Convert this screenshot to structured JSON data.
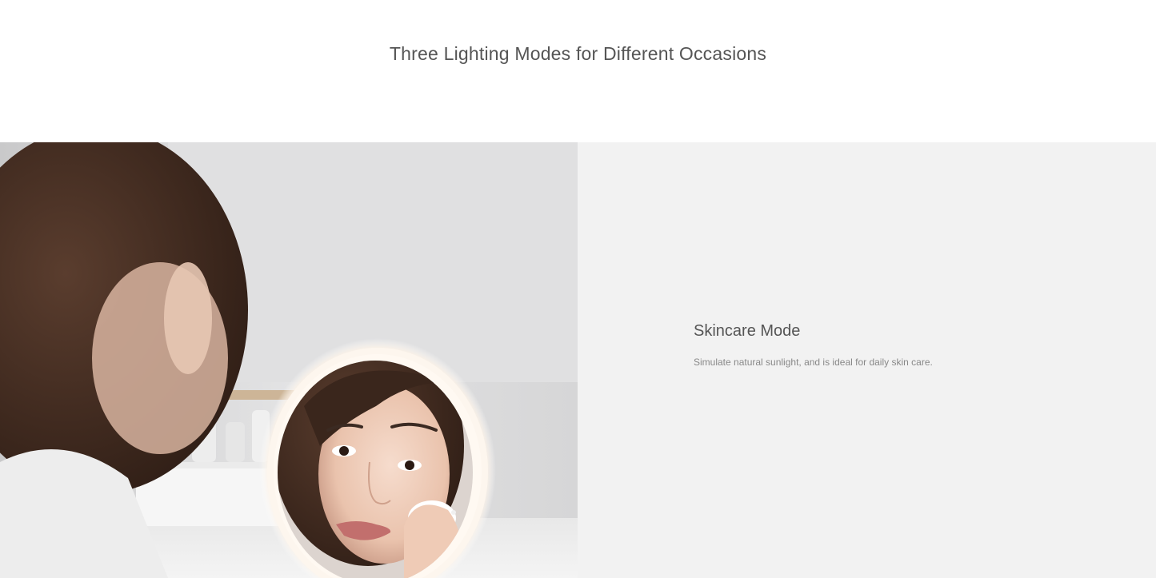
{
  "section": {
    "title": "Three Lighting Modes for Different Occasions"
  },
  "feature": {
    "mode_title": "Skincare Mode",
    "mode_description": "Simulate natural sunlight, and is ideal for daily skin care.",
    "image_subject": "woman-looking-into-lighted-round-mirror"
  },
  "colors": {
    "page_background": "#ffffff",
    "info_panel_background": "#f2f2f2",
    "title_text": "#555555",
    "description_text": "#888888"
  }
}
